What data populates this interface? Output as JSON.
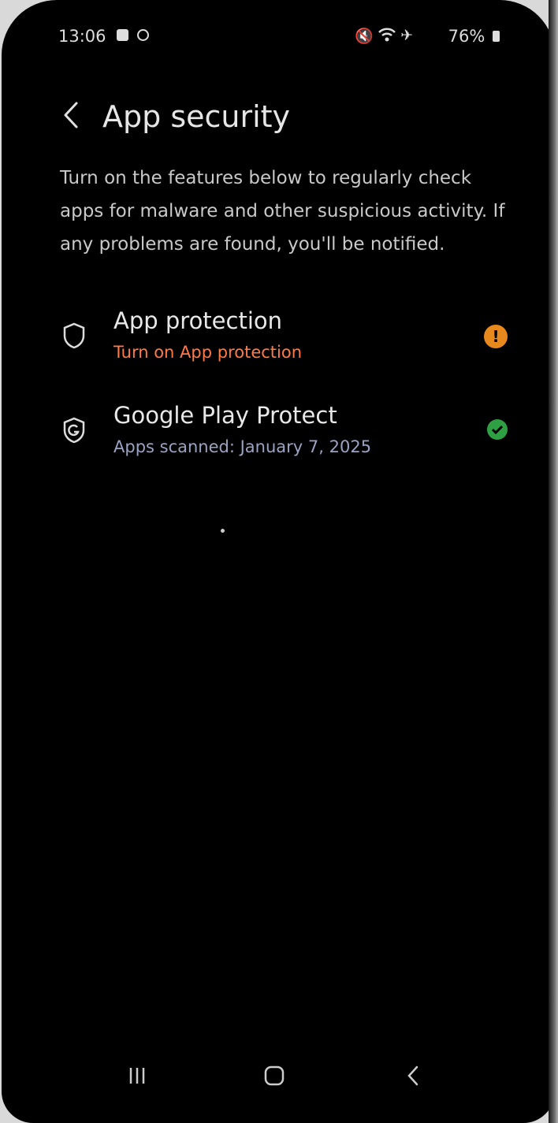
{
  "status_bar": {
    "time": "13:06",
    "battery": "76%",
    "icons": [
      "checkbox-notification-icon",
      "circle-notification-icon",
      "mute-icon",
      "wifi-icon",
      "airplane-icon",
      "battery-icon"
    ]
  },
  "header": {
    "title": "App security",
    "back_icon": "chevron-left-icon"
  },
  "description": "Turn on the features below to regularly check apps for malware and other suspicious activity. If any problems are found, you'll be notified.",
  "items": [
    {
      "title": "App protection",
      "subtitle": "Turn on App protection",
      "icon": "shield-icon",
      "status_icon": "warning-icon",
      "status_color": "#e8891e",
      "subtitle_color": "#ff7a45"
    },
    {
      "title": "Google Play Protect",
      "subtitle": "Apps scanned: January 7, 2025",
      "icon": "google-shield-icon",
      "status_icon": "check-icon",
      "status_color": "#2ea043",
      "subtitle_color": "#9aa3c4"
    }
  ],
  "navbar": {
    "items": [
      "recents-icon",
      "home-icon",
      "back-icon"
    ]
  },
  "colors": {
    "background": "#000000",
    "text_primary": "#e6e6e6",
    "text_secondary": "#c9c9c9"
  }
}
